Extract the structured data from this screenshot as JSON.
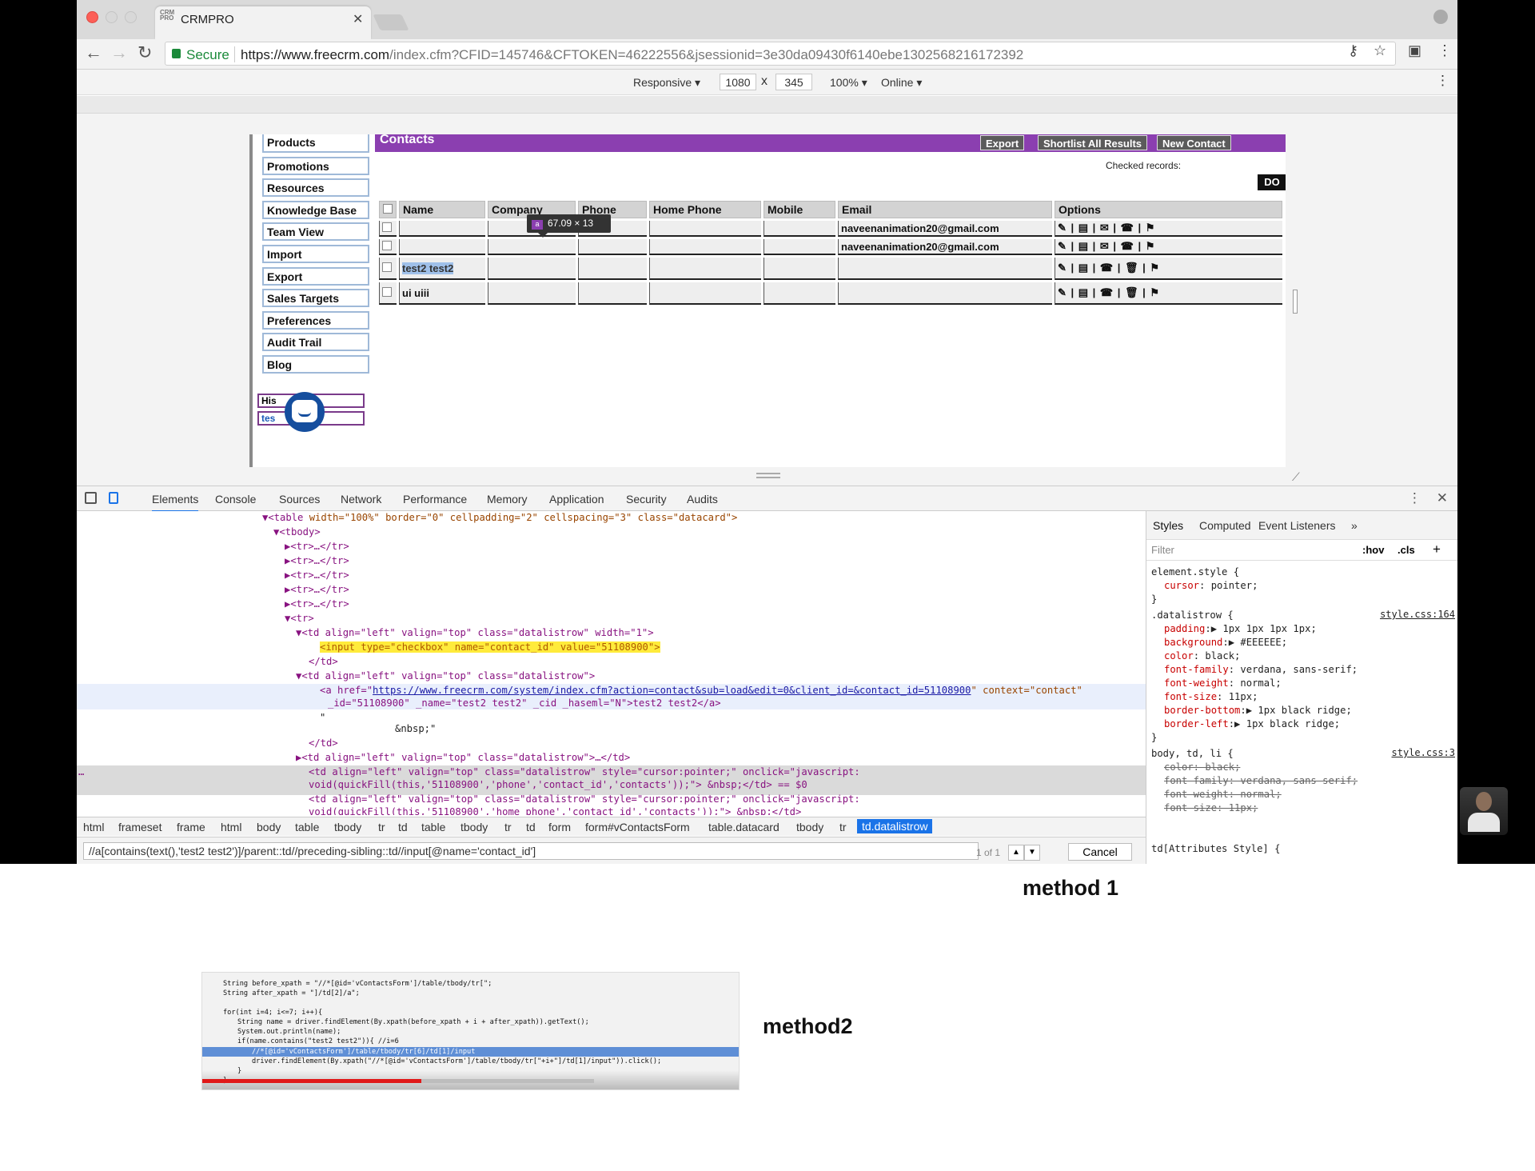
{
  "browser": {
    "tab_title": "CRMPRO",
    "tab_favicon": "CRM PRO",
    "secure_label": "Secure",
    "url_main": "https://www.freecrm.com",
    "url_rest": "/index.cfm?CFID=145746&CFTOKEN=46222556&jsessionid=3e30da09430f6140ebe1302568216172392"
  },
  "device_toolbar": {
    "mode": "Responsive",
    "width": "1080",
    "times": "x",
    "height": "345",
    "zoom": "100%",
    "network": "Online"
  },
  "sidebar": {
    "items": [
      "Products",
      "Promotions",
      "Resources",
      "Knowledge Base",
      "Team View",
      "Import",
      "Export",
      "Sales Targets",
      "Preferences",
      "Audit Trail",
      "Blog"
    ],
    "input1": "His",
    "input2": "tes"
  },
  "contacts": {
    "title": "Contacts",
    "buttons": {
      "export": "Export",
      "shortlist": "Shortlist All Results",
      "new_contact": "New Contact"
    },
    "checked_records": "Checked records:",
    "do": "DO",
    "columns": [
      "Name",
      "Company",
      "Phone",
      "Home Phone",
      "Mobile",
      "Email",
      "Options"
    ],
    "rows": [
      {
        "name": "",
        "email": "naveenanimation20@gmail.com",
        "options": "✎ | ▤ | ✉ | ☎ | ⚑"
      },
      {
        "name": "",
        "email": "naveenanimation20@gmail.com",
        "options": "✎ | ▤ | ✉ | ☎ | ⚑"
      },
      {
        "name": "test2 test2",
        "email": "",
        "options": "✎ | ▤ | ☎ | 🗑 | ⚑"
      },
      {
        "name": "ui uiii",
        "email": "",
        "options": "✎ | ▤ | ☎ | 🗑 | ⚑"
      }
    ],
    "tooltip_tag": "a",
    "tooltip_size": "67.09 × 13"
  },
  "devtools": {
    "tabs": [
      "Elements",
      "Console",
      "Sources",
      "Network",
      "Performance",
      "Memory",
      "Application",
      "Security",
      "Audits"
    ],
    "active_tab": "Elements",
    "code": {
      "l1_tag": "▼<table",
      "l1_attrs": " width=\"100%\" border=\"0\" cellpadding=\"2\" cellspacing=\"3\" class=\"datacard\">",
      "l2": "▼<tbody>",
      "tr_collapsed": "▶<tr>…</tr>",
      "tr_open": "▼<tr>",
      "td1": "▼<td align=\"left\" valign=\"top\" class=\"datalistrow\" width=\"1\">",
      "input": "<input type=\"checkbox\" name=\"contact_id\" value=\"51108900\">",
      "td_close": "</td>",
      "td2": "▼<td align=\"left\" valign=\"top\" class=\"datalistrow\">",
      "a_line1_pre": "<a href=\"",
      "a_href": "https://www.freecrm.com/system/index.cfm?action=contact&sub=load&edit=0&client_id=&contact_id=51108900",
      "a_line1_post": "\" context=\"contact\"",
      "a_line2": "_id=\"51108900\" _name=\"test2 test2\" _cid _haseml=\"N\">test2 test2</a>",
      "quote": "\"",
      "nbsp": "&nbsp;\"",
      "td3": "▶<td align=\"left\" valign=\"top\" class=\"datalistrow\">…</td>",
      "td4a": "<td align=\"left\" valign=\"top\" class=\"datalistrow\" style=\"cursor:pointer;\" onclick=\"javascript:",
      "td4b": "void(quickFill(this,'51108900','phone','contact_id','contacts'));\">  &nbsp;</td> == $0",
      "td5a": "<td align=\"left\" valign=\"top\" class=\"datalistrow\" style=\"cursor:pointer;\" onclick=\"javascript:",
      "td5b": "void(quickFill(this,'51108900','home_phone','contact_id','contacts'));\"> &nbsp;</td>",
      "dots": "…"
    },
    "breadcrumbs": [
      "html",
      "frameset",
      "frame",
      "html",
      "body",
      "table",
      "tbody",
      "tr",
      "td",
      "table",
      "tbody",
      "tr",
      "td",
      "form",
      "form#vContactsForm",
      "table.datacard",
      "tbody",
      "tr",
      "td.datalistrow"
    ],
    "search_value": "//a[contains(text(),'test2 test2')]/parent::td//preceding-sibling::td//input[@name='contact_id']",
    "match_count": "1 of 1",
    "up": "▲",
    "down": "▼",
    "cancel": "Cancel",
    "styles_tabs": [
      "Styles",
      "Computed",
      "Event Listeners",
      "»"
    ],
    "filter_placeholder": "Filter",
    "filter_hov": ":hov",
    "filter_cls": ".cls",
    "filter_plus": "+",
    "styles": {
      "element_style": "element.style {",
      "cursor_prop": "cursor",
      "cursor_val": ": pointer;",
      "close": "}",
      "dl_sel": ".datalistrow {",
      "dl_src": "style.css:164",
      "padding_prop": "padding",
      "padding_val": ":▶ 1px 1px 1px 1px;",
      "bg_prop": "background",
      "bg_val": ":▶ #EEEEEE;",
      "color_prop": "color",
      "color_val": ": black;",
      "ff_prop": "font-family",
      "ff_val": ": verdana, sans-serif;",
      "fw_prop": "font-weight",
      "fw_val": ": normal;",
      "fs_prop": "font-size",
      "fs_val": ": 11px;",
      "bb_prop": "border-bottom",
      "bb_val": ":▶ 1px  black ridge;",
      "bl_prop": "border-left",
      "bl_val": ":▶ 1px  black ridge;",
      "body_sel": "body, td, li {",
      "body_src": "style.css:3",
      "s_color": "color:  black;",
      "s_ff": "font-family: verdana, sans-serif;",
      "s_fw": "font-weight: normal;",
      "s_fs": "font-size: 11px;",
      "td_attr": "td[Attributes Style] {"
    }
  },
  "colors": {
    "contacts_header": "#8b3fb0",
    "datalist_bg": "#EEEEEE",
    "highlight_input": "#ffeb3b",
    "progress": "#e01818"
  },
  "labels": {
    "method1": "method 1",
    "method2": "method2"
  },
  "code_thumb": {
    "l1": "String before_xpath = \"//*[@id='vContactsForm']/table/tbody/tr[\";",
    "l2": "String after_xpath = \"]/td[2]/a\";",
    "l3": "for(int i=4; i<=7; i++){",
    "l4": "String name = driver.findElement(By.xpath(before_xpath + i + after_xpath)).getText();",
    "l5": "System.out.println(name);",
    "l6": "if(name.contains(\"test2 test2\")){ //i=6",
    "l7": "//*[@id='vContactsForm']/table/tbody/tr[6]/td[1]/input",
    "l8": "driver.findElement(By.xpath(\"//*[@id='vContactsForm']/table/tbody/tr[\"+i+\"]/td[1]/input\")).click();",
    "l9": "}",
    "l10": "}",
    "progress": 0.56
  }
}
